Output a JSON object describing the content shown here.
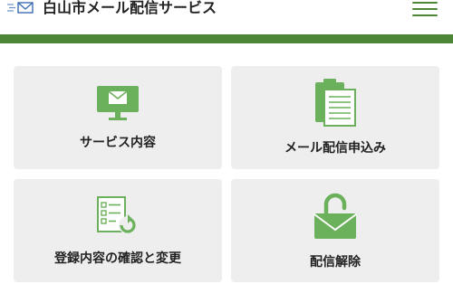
{
  "header": {
    "title": "白山市メール配信サービス",
    "logo_icon": "mail-logo-icon",
    "menu_icon": "hamburger-menu-icon"
  },
  "colors": {
    "accent": "#4c8636",
    "icon_green": "#6bb05a",
    "card_bg": "#eeeeee"
  },
  "menu": {
    "items": [
      {
        "label": "サービス内容",
        "icon": "monitor-mail-icon"
      },
      {
        "label": "メール配信申込み",
        "icon": "clipboard-icon"
      },
      {
        "label": "登録内容の確認と変更",
        "icon": "checklist-refresh-icon"
      },
      {
        "label": "配信解除",
        "icon": "unlocked-mail-icon"
      }
    ]
  }
}
